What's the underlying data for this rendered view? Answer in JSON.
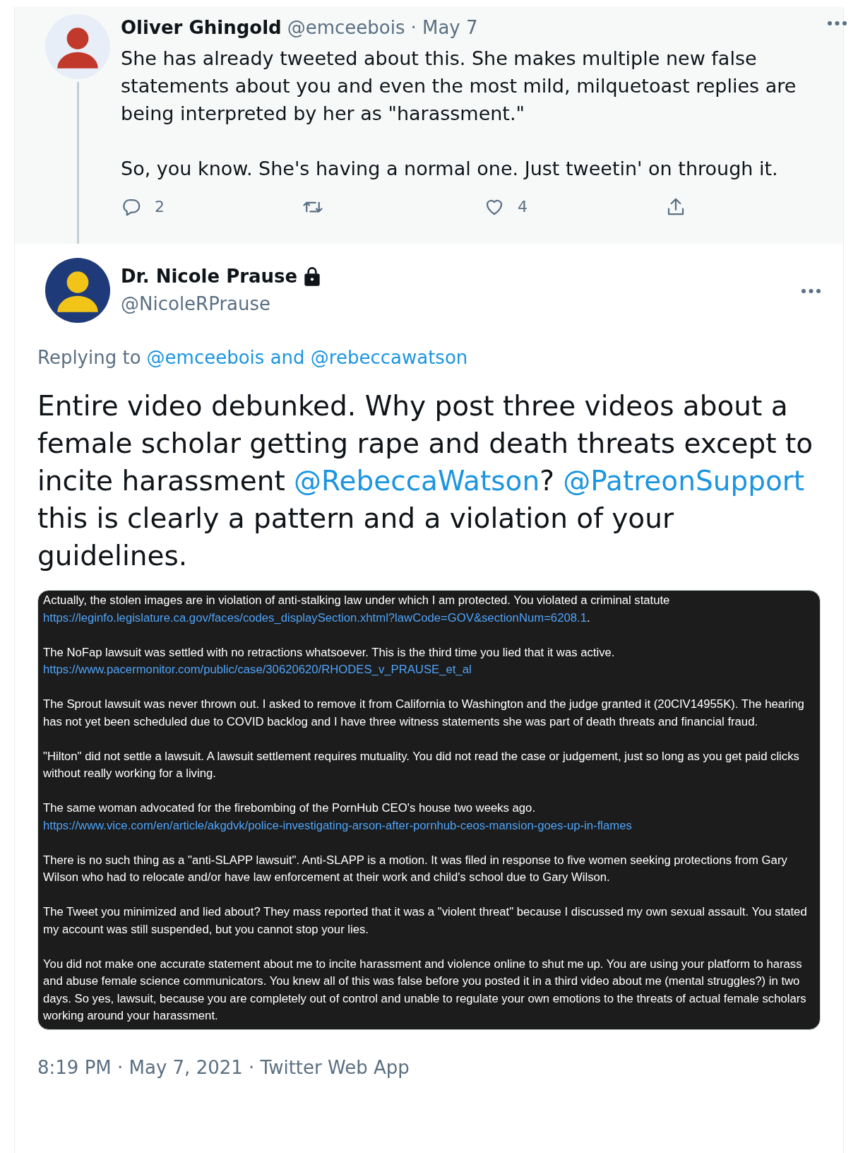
{
  "parent_tweet": {
    "author_name": "Oliver Ghingold",
    "handle": "@emceebois",
    "date": "· May 7",
    "text": "She has already tweeted about this. She makes multiple new false statements about you and even the most mild, milquetoast replies are being interpreted by her as \"harassment.\"\n\nSo, you know. She's having a normal one. Just tweetin' on through it.",
    "actions": [
      {
        "kind": "reply",
        "count": "2"
      },
      {
        "kind": "retweet"
      },
      {
        "kind": "like",
        "count": "4"
      },
      {
        "kind": "share"
      }
    ]
  },
  "tweet": {
    "author_name": "Dr. Nicole Prause",
    "protected": true,
    "handle": "@NicoleRPrause",
    "replying_label": "Replying to",
    "replying_to": "@emceebois and @rebeccawatson",
    "text": [
      {
        "kind": "plain",
        "text": "Entire video debunked. Why post three videos about a female scholar getting rape and death threats except to incite harassment "
      },
      {
        "kind": "mention",
        "text": "@RebeccaWatson"
      },
      {
        "kind": "plain",
        "text": "? "
      },
      {
        "kind": "mention",
        "text": "@PatreonSupport"
      },
      {
        "kind": "plain",
        "text": " this is clearly a pattern and a violation of your guidelines."
      }
    ],
    "attached_screenshot": [
      [
        {
          "kind": "plain",
          "text": "Actually, the stolen images are in violation of anti-stalking law under which I am protected. You violated a criminal statute"
        },
        {
          "kind": "link",
          "text": "https://leginfo.legislature.ca.gov/faces/codes_displaySection.xhtml?lawCode=GOV&sectionNum=6208.1"
        },
        {
          "kind": "plain",
          "text": "."
        }
      ],
      [
        {
          "kind": "plain",
          "text": "The NoFap lawsuit was settled with no retractions whatsoever. This is the third time you lied that it was active."
        },
        {
          "kind": "link",
          "text": "https://www.pacermonitor.com/public/case/30620620/RHODES_v_PRAUSE_et_al"
        }
      ],
      [
        {
          "kind": "plain",
          "text": "The Sprout lawsuit was never thrown out. I asked to remove it from California to Washington and the judge granted it (20CIV14955K). The hearing has not yet been scheduled due to COVID backlog and I have three witness statements she was part of death threats and financial fraud."
        }
      ],
      [
        {
          "kind": "plain",
          "text": "\"Hilton\" did not settle a lawsuit.  A lawsuit settlement requires mutuality. You did not read the case or judgement, just so long as you get paid clicks without really working for a living."
        }
      ],
      [
        {
          "kind": "plain",
          "text": "The same woman advocated for the firebombing of the PornHub CEO's house two weeks ago."
        },
        {
          "kind": "link",
          "text": "https://www.vice.com/en/article/akgdvk/police-investigating-arson-after-pornhub-ceos-mansion-goes-up-in-flames"
        }
      ],
      [
        {
          "kind": "plain",
          "text": "There is no such thing as a \"anti-SLAPP lawsuit\". Anti-SLAPP is a motion. It was filed in response to five women seeking protections from Gary Wilson who had to relocate and/or have law enforcement at their work and child's school due to Gary Wilson."
        }
      ],
      [
        {
          "kind": "plain",
          "text": "The Tweet you minimized and lied about? They mass reported that it was a \"violent threat\" because I discussed my own sexual assault. You stated my account was still suspended, but you cannot stop your lies."
        }
      ],
      [
        {
          "kind": "plain",
          "text": "You did not make one accurate statement about me to incite harassment and violence online to shut me up. You are using your platform to harass and abuse female science communicators. You knew all of this was false before you posted it in a third video about me (mental struggles?) in two days.  So yes, lawsuit, because you are completely out of control and unable to regulate your own emotions to the threats of actual female scholars working around your harassment."
        }
      ]
    ],
    "timestamp": "8:19 PM · May 7, 2021 · Twitter Web App"
  }
}
